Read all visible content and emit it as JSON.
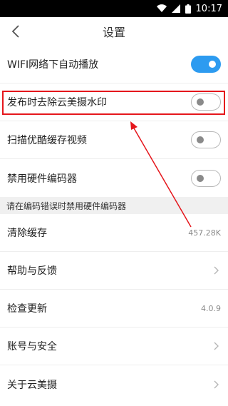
{
  "status_bar": {
    "time": "10:17",
    "icons": [
      "wifi-icon",
      "signal-icon",
      "battery-icon"
    ]
  },
  "header": {
    "title": "设置",
    "back_icon": "chevron-left-icon"
  },
  "settings": {
    "wifi_autoplay": {
      "label": "WIFI网络下自动播放",
      "enabled": true
    },
    "remove_watermark": {
      "label": "发布时去除云美摄水印",
      "enabled": false
    },
    "scan_youku": {
      "label": "扫描优酷缓存视频",
      "enabled": false
    },
    "disable_hw_encoder": {
      "label": "禁用硬件编码器",
      "enabled": false
    },
    "encoder_hint": "请在编码错误时禁用硬件编码器",
    "clear_cache": {
      "label": "清除缓存",
      "value": "457.28K"
    },
    "help_feedback": {
      "label": "帮助与反馈"
    },
    "check_update": {
      "label": "检查更新",
      "value": "4.0.9"
    },
    "account_security": {
      "label": "账号与安全"
    },
    "about": {
      "label": "关于云美摄"
    }
  },
  "colors": {
    "toggle_on": "#2d9bf0",
    "annotation_red": "#e5161c"
  }
}
